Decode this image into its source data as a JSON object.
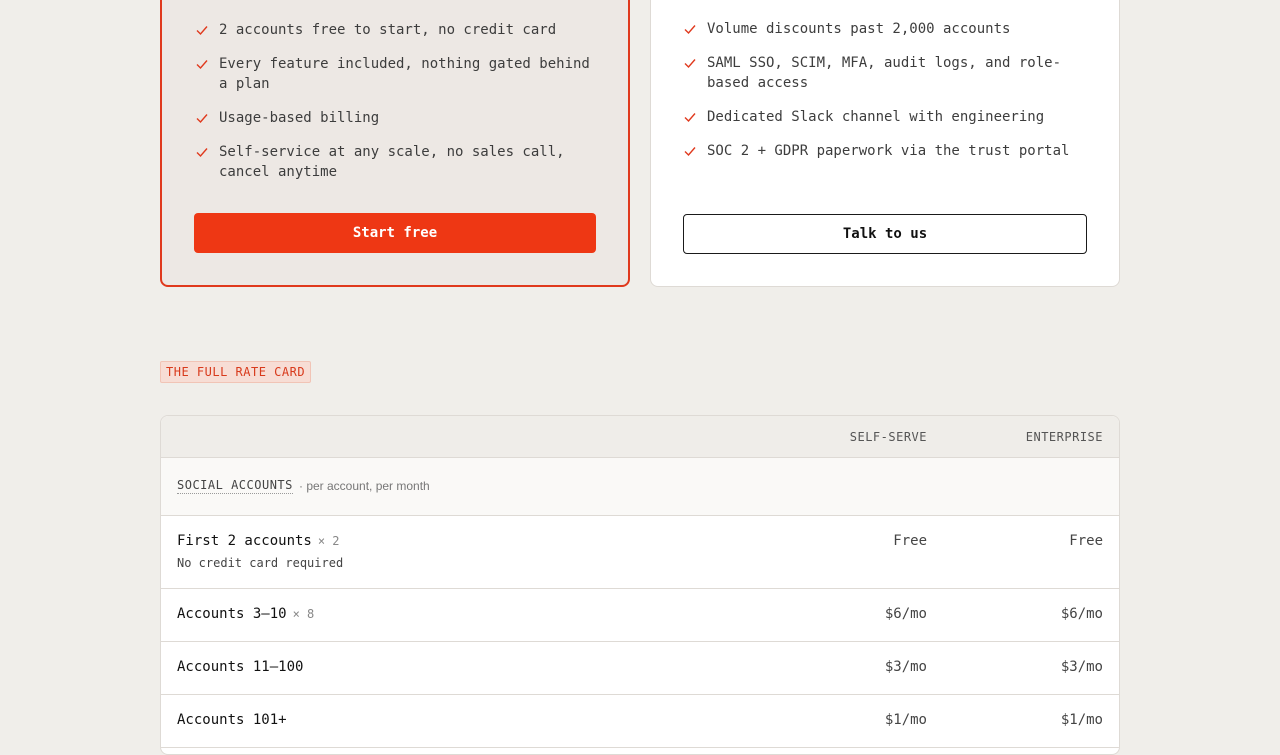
{
  "plans": {
    "self_serve": {
      "features": [
        "2 accounts free to start, no credit card",
        "Every feature included, nothing gated behind a plan",
        "Usage-based billing",
        "Self-service at any scale, no sales call, cancel anytime"
      ],
      "cta_label": "Start free"
    },
    "enterprise": {
      "features": [
        "Volume discounts past 2,000 accounts",
        "SAML SSO, SCIM, MFA, audit logs, and role-based access",
        "Dedicated Slack channel with engineering",
        "SOC 2 + GDPR paperwork via the trust portal"
      ],
      "cta_label": "Talk to us"
    }
  },
  "rate_card": {
    "tag": "THE FULL RATE CARD",
    "columns": {
      "self_serve": "SELF-SERVE",
      "enterprise": "ENTERPRISE"
    },
    "group": {
      "title": "SOCIAL ACCOUNTS",
      "note": "· per account, per month"
    },
    "rows": [
      {
        "label": "First 2 accounts",
        "qty": "× 2",
        "sub": "No credit card required",
        "self_serve": "Free",
        "enterprise": "Free"
      },
      {
        "label": "Accounts 3–10",
        "qty": "× 8",
        "sub": "",
        "self_serve": "$6/mo",
        "enterprise": "$6/mo"
      },
      {
        "label": "Accounts 11–100",
        "qty": "",
        "sub": "",
        "self_serve": "$3/mo",
        "enterprise": "$3/mo"
      },
      {
        "label": "Accounts 101+",
        "qty": "",
        "sub": "",
        "self_serve": "$1/mo",
        "enterprise": "$1/mo"
      }
    ]
  },
  "colors": {
    "accent": "#ee3714",
    "background": "#f0eeea",
    "card_highlight": "#ede8e4",
    "tag_background": "#f7ddd5"
  },
  "icons": {
    "feature_bullet": "check-icon"
  }
}
